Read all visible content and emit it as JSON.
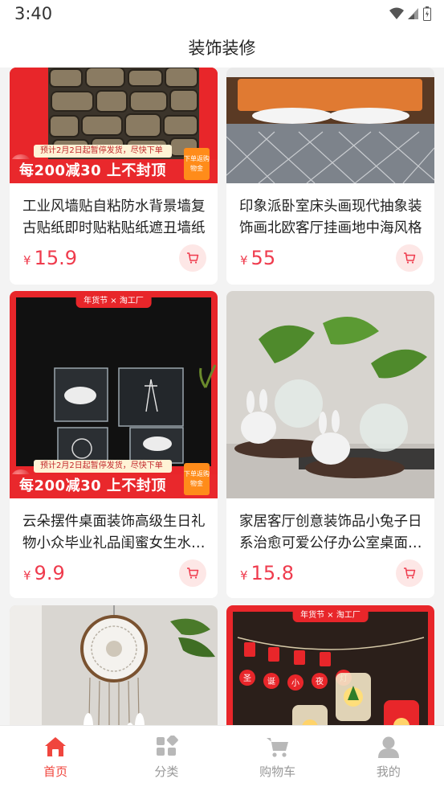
{
  "status_bar": {
    "time": "3:40"
  },
  "header": {
    "title": "装饰装修"
  },
  "products": [
    {
      "name": "工业风墙贴自粘防水背景墙复古贴纸即时贴粘贴纸遮丑墙纸",
      "currency": "¥",
      "price": "15.9",
      "promo": {
        "top": "预计2月2日起暂停发货，尽快下单",
        "main": "每200减30 上不封顶",
        "gift": "下单返购物金"
      }
    },
    {
      "name": "印象派卧室床头画现代抽象装饰画北欧客厅挂画地中海风格",
      "currency": "¥",
      "price": "55"
    },
    {
      "name": "云朵摆件桌面装饰高级生日礼物小众毕业礼品闺蜜女生水晶球",
      "currency": "¥",
      "price": "9.9",
      "ribbon": "年货节 × 淘工厂",
      "promo": {
        "top": "预计2月2日起暂停发货，尽快下单",
        "main": "每200减30 上不封顶",
        "gift": "下单返购物金"
      }
    },
    {
      "name": "家居客厅创意装饰品小兔子日系治愈可爱公仔办公室桌面摆件",
      "currency": "¥",
      "price": "15.8"
    },
    {
      "name": "",
      "currency": "",
      "price": ""
    },
    {
      "name": "",
      "currency": "",
      "price": "",
      "ribbon": "年货节 × 淘工厂"
    }
  ],
  "tabs": [
    {
      "label": "首页",
      "icon": "home-icon",
      "active": true
    },
    {
      "label": "分类",
      "icon": "category-icon",
      "active": false
    },
    {
      "label": "购物车",
      "icon": "cart-icon",
      "active": false
    },
    {
      "label": "我的",
      "icon": "profile-icon",
      "active": false
    }
  ],
  "colors": {
    "accent": "#f0463e",
    "price": "#ef3b4d",
    "promo_red": "#e9282c",
    "inactive": "#999999"
  }
}
